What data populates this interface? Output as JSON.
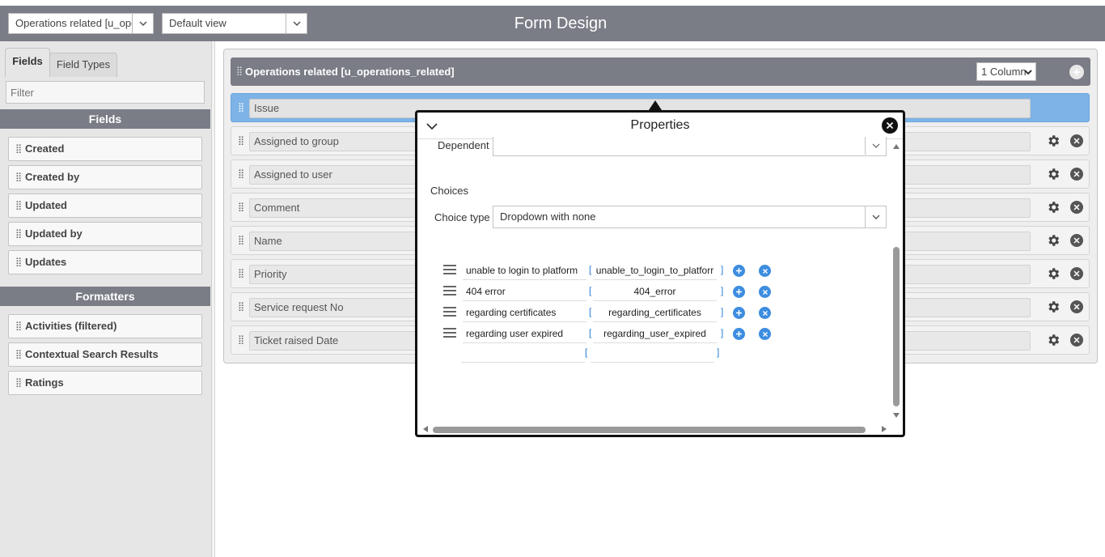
{
  "header": {
    "table_select": "Operations related [u_oper",
    "view_select": "Default view",
    "title": "Form Design"
  },
  "left_panel": {
    "tabs": [
      {
        "label": "Fields",
        "active": true
      },
      {
        "label": "Field Types",
        "active": false
      }
    ],
    "filter_placeholder": "Filter",
    "fields_header": "Fields",
    "fields": [
      "Created",
      "Created by",
      "Updated",
      "Updated by",
      "Updates"
    ],
    "formatters_header": "Formatters",
    "formatters": [
      "Activities (filtered)",
      "Contextual Search Results",
      "Ratings"
    ]
  },
  "form": {
    "section_title": "Operations related [u_operations_related]",
    "column_select": "1 Column",
    "fields": [
      {
        "label": "Issue",
        "selected": true
      },
      {
        "label": "Assigned to group",
        "selected": false
      },
      {
        "label": "Assigned to user",
        "selected": false
      },
      {
        "label": "Comment",
        "selected": false
      },
      {
        "label": "Name",
        "selected": false
      },
      {
        "label": "Priority",
        "selected": false
      },
      {
        "label": "Service request No",
        "selected": false
      },
      {
        "label": "Ticket raised Date",
        "selected": false
      }
    ]
  },
  "properties": {
    "title": "Properties",
    "dependent_label": "Dependent",
    "dependent_value": "",
    "choices_heading": "Choices",
    "choice_type_label": "Choice type",
    "choice_type_value": "Dropdown with none",
    "choices": [
      {
        "label": "unable to login to platform",
        "value": "unable_to_login_to_platforr"
      },
      {
        "label": "404 error",
        "value": "404_error"
      },
      {
        "label": "regarding certificates",
        "value": "regarding_certificates"
      },
      {
        "label": "regarding user expired",
        "value": "regarding_user_expired"
      }
    ],
    "new_choice": {
      "label": "",
      "value": ""
    },
    "bracket_open": "[",
    "bracket_close": "]"
  },
  "colors": {
    "header_bg": "#7a7c86",
    "selected_row": "#7db3e6",
    "accent_blue": "#3d8de0"
  }
}
